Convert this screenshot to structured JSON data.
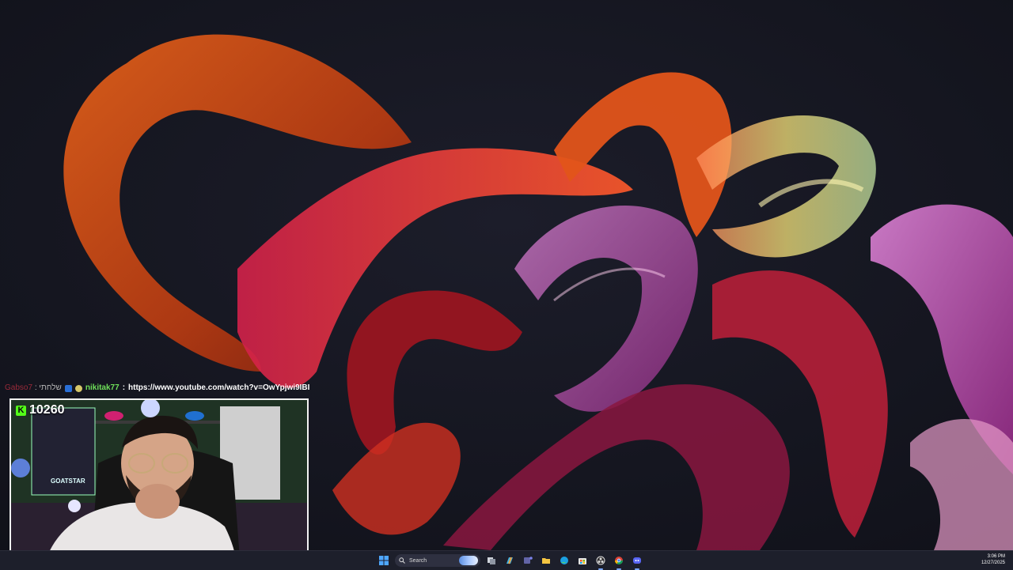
{
  "chat": {
    "prev_user": "Gabso7",
    "prev_sep": ":",
    "prev_message": "שלחתי",
    "user": "nikitak77",
    "sep": ":",
    "message": "https://www.youtube.com/watch?v=OwYpjwi9IBI"
  },
  "webcam": {
    "kick_logo": "K",
    "kick_count": "10260",
    "poster_text": "GOATSTAR"
  },
  "taskbar": {
    "search_label": "Search",
    "time": "3:06 PM",
    "date": "12/27/2025",
    "icons": [
      "windows-start-icon",
      "search-icon",
      "task-view-icon",
      "copilot-icon",
      "teams-icon",
      "file-explorer-icon",
      "edge-icon",
      "store-icon",
      "obs-icon",
      "chrome-icon",
      "discord-icon"
    ]
  },
  "colors": {
    "wallpaper_bg": "#14151f",
    "kick_green": "#53fc18",
    "chat_user": "#6fe05a",
    "taskbar": "#1d1f2b"
  }
}
